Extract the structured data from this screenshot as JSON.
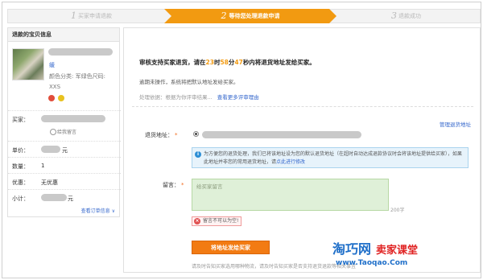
{
  "steps": {
    "step1": {
      "num": "1",
      "label": "买家申请退款"
    },
    "step2": {
      "num": "2",
      "label": "等待您处理退款申请"
    },
    "step3": {
      "num": "3",
      "label": "退款成功"
    }
  },
  "sidebar": {
    "title": "退款的宝贝信息",
    "item_link": "缓",
    "item_spec": "颜色分类: 军绿色尺码: XXS",
    "buyer_label": "买家：",
    "wangwang_label": "给我留言",
    "price_label": "单价：",
    "price_suffix": "元",
    "qty_label": "数量：",
    "qty_value": "1",
    "discount_label": "优惠：",
    "discount_value": "无优惠",
    "subtotal_label": "小计：",
    "subtotal_suffix": "元",
    "view_order": "查看订单信息"
  },
  "main": {
    "headline_pre": "审核支持买家退货，请在",
    "hours": "23",
    "hours_unit": "时",
    "minutes": "58",
    "minutes_unit": "分",
    "seconds": "47",
    "headline_post": "秒内将退货地址发给买家。",
    "sub": "逾期未操作，系统将把默认地址发给买家。",
    "process": "处理依据：根据为你评审结果...",
    "process_link": "查看更多评审理由",
    "manage_link": "管理退货地址",
    "address_label": "退货地址：",
    "required": "*",
    "info_text": "为方便您的退货处理，我们已将该地址设为您的默认退货地址（在超时自动达成退款协议时会将该地址提供给买家），如果此地址并非您的常用退货地址，请",
    "info_link": "点此进行修改",
    "message_label": "留言：",
    "message_placeholder": "给买家留言",
    "char_count": "200字",
    "error_text": "留言不可以为空!",
    "submit_label": "将地址发给买家",
    "notice": "请及时告知买家选用哪种物流，请及时告知买家是否支持退货退款等相关事宜"
  },
  "watermark": {
    "brand": "淘巧网",
    "channel": "卖家课堂",
    "url": "www.Taoqao.Com"
  }
}
